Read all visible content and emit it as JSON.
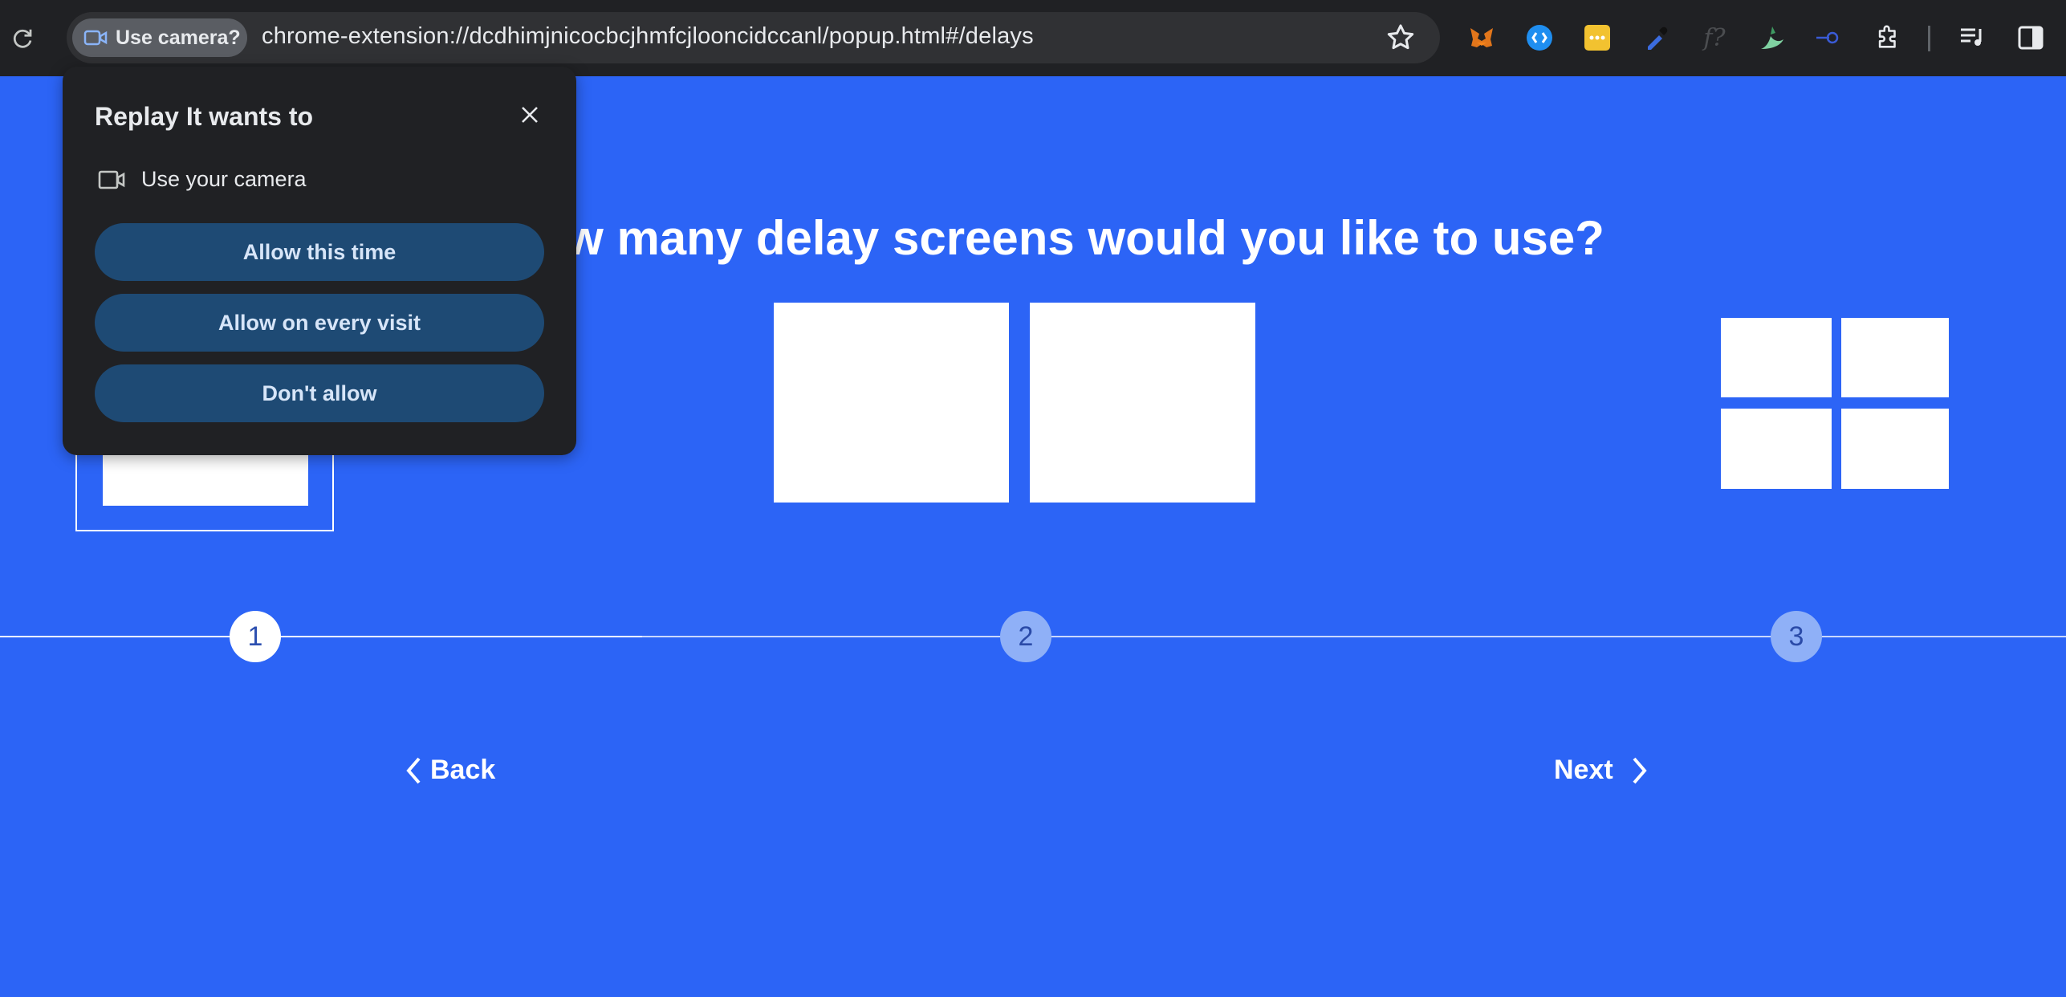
{
  "browser": {
    "chip_label": "Use camera?",
    "url": "chrome-extension://dcdhimjnicocbcjhmfcjlooncidccanl/popup.html#/delays"
  },
  "page": {
    "heading": "How many delay screens would you like to use?",
    "steps": [
      "1",
      "2",
      "3"
    ],
    "active_step": 1,
    "back_label": "Back",
    "next_label": "Next",
    "background_color": "#2c64f6"
  },
  "popup": {
    "title": "Replay It wants to",
    "permission": "Use your camera",
    "buttons": [
      "Allow this time",
      "Allow on every visit",
      "Don't allow"
    ]
  }
}
